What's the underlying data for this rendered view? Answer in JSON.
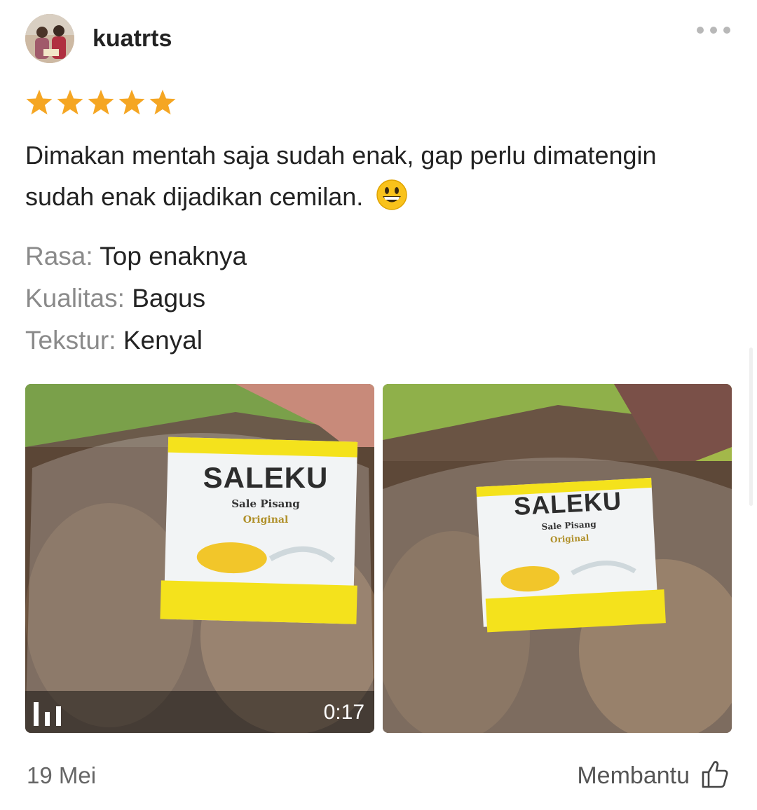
{
  "review": {
    "username": "kuatrts",
    "rating": 5,
    "rating_max": 5,
    "text": "Dimakan mentah saja sudah enak, gap perlu dimatengin sudah enak dijadikan cemilan.",
    "emoji": "grinning-face",
    "attributes": [
      {
        "key": "Rasa:",
        "value": "Top enaknya"
      },
      {
        "key": "Kualitas:",
        "value": "Bagus"
      },
      {
        "key": "Tekstur:",
        "value": "Kenyal"
      }
    ],
    "media": [
      {
        "type": "video",
        "duration": "0:17",
        "label_brand": "SALEKU",
        "label_sub": "Sale Pisang",
        "label_variant": "Original"
      },
      {
        "type": "image",
        "label_brand": "SALEKU",
        "label_sub": "Sale Pisang",
        "label_variant": "Original"
      }
    ],
    "date": "19 Mei",
    "helpful_label": "Membantu"
  },
  "colors": {
    "star": "#f5a623",
    "text": "#222222",
    "muted": "#8a8a8a",
    "label_yellow": "#f4e21c"
  },
  "icons": {
    "more": "more-horizontal-icon",
    "video": "video-bars-icon",
    "helpful": "thumbs-up-icon"
  }
}
